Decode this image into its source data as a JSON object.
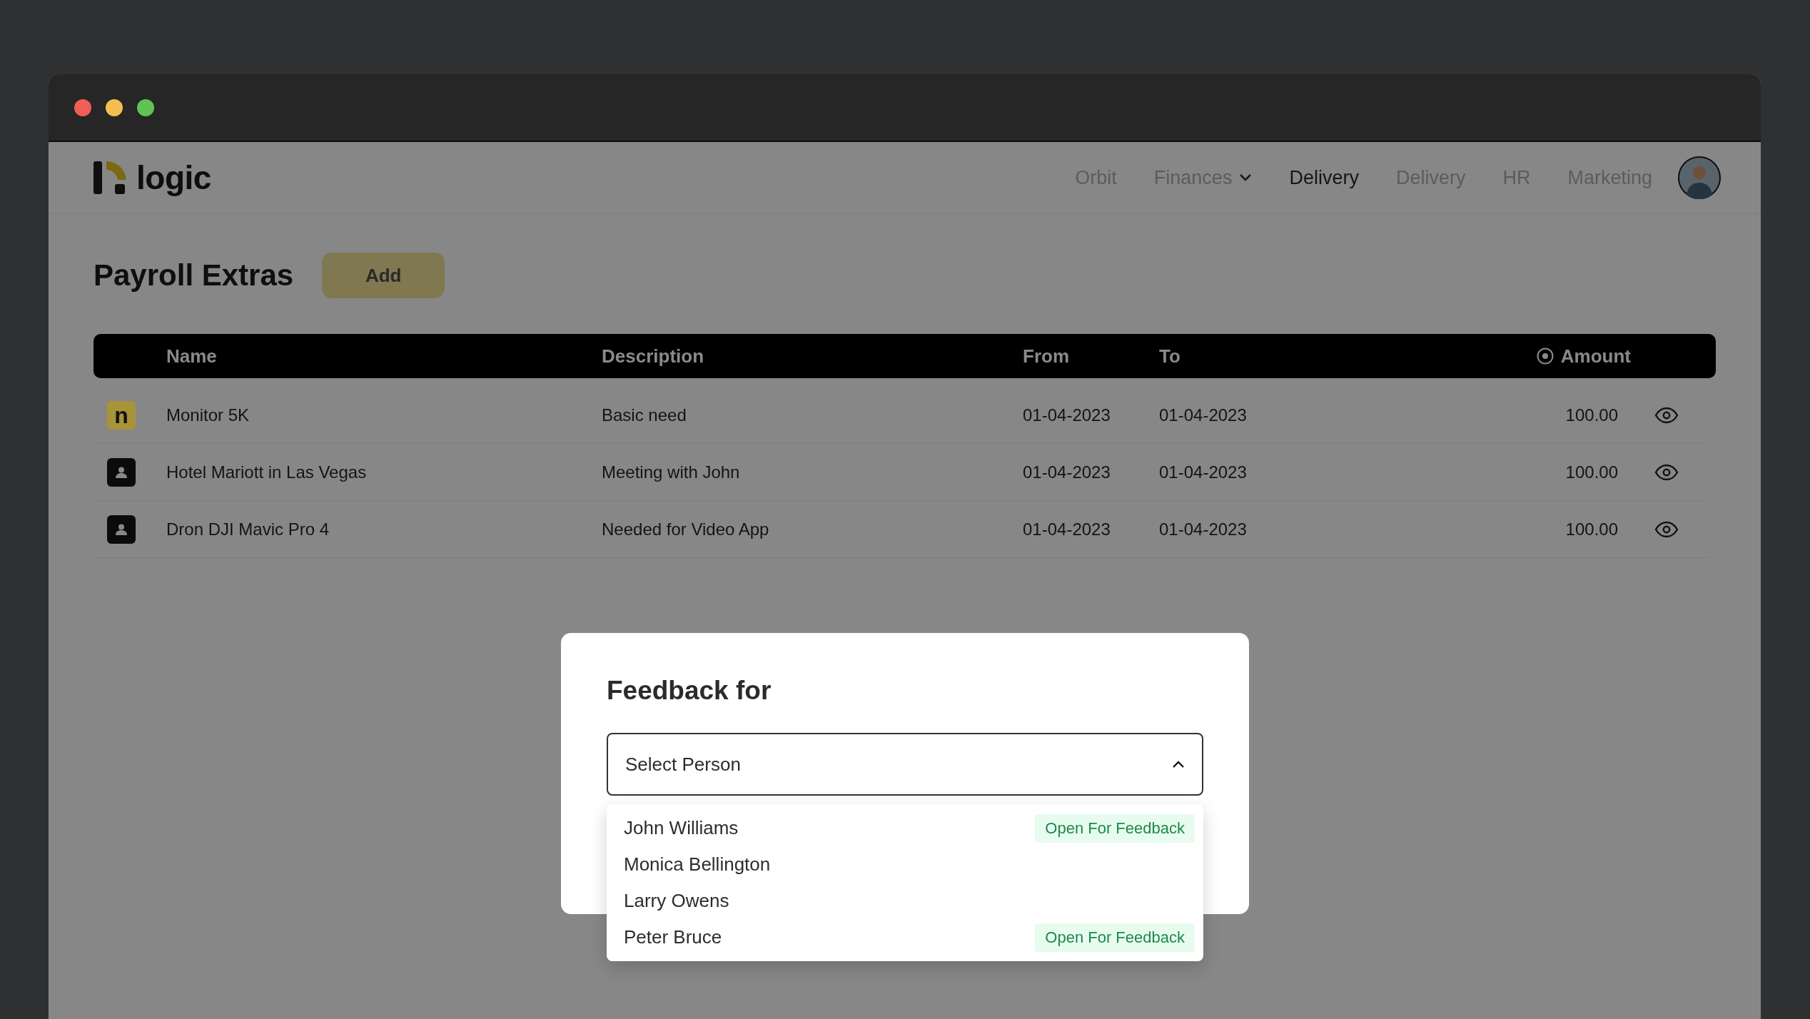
{
  "brand": {
    "name": "logic"
  },
  "nav": [
    {
      "label": "Orbit",
      "selected": false,
      "dropdown": false
    },
    {
      "label": "Finances",
      "selected": false,
      "dropdown": true
    },
    {
      "label": "Delivery",
      "selected": true,
      "dropdown": false
    },
    {
      "label": "Delivery",
      "selected": false,
      "dropdown": false
    },
    {
      "label": "HR",
      "selected": false,
      "dropdown": false
    },
    {
      "label": "Marketing",
      "selected": false,
      "dropdown": false
    }
  ],
  "page": {
    "title": "Payroll Extras",
    "add_button": "Add"
  },
  "table": {
    "columns": [
      "Name",
      "Description",
      "From",
      "To",
      "Amount"
    ],
    "rows": [
      {
        "kind": "letter",
        "badge": "n",
        "name": "Monitor 5K",
        "description": "Basic need",
        "from": "01-04-2023",
        "to": "01-04-2023",
        "amount": "100.00"
      },
      {
        "kind": "person",
        "name": "Hotel Mariott in Las Vegas",
        "description": "Meeting with John",
        "from": "01-04-2023",
        "to": "01-04-2023",
        "amount": "100.00"
      },
      {
        "kind": "person",
        "name": "Dron DJI Mavic Pro 4",
        "description": "Needed for Video App",
        "from": "01-04-2023",
        "to": "01-04-2023",
        "amount": "100.00"
      }
    ]
  },
  "modal": {
    "title": "Feedback for",
    "select": {
      "placeholder": "Select Person",
      "expanded": true
    },
    "options": [
      {
        "name": "John Williams",
        "badge": "Open For Feedback"
      },
      {
        "name": "Monica Bellington"
      },
      {
        "name": "Larry Owens"
      },
      {
        "name": "Peter Bruce",
        "badge": "Open For Feedback"
      }
    ]
  }
}
